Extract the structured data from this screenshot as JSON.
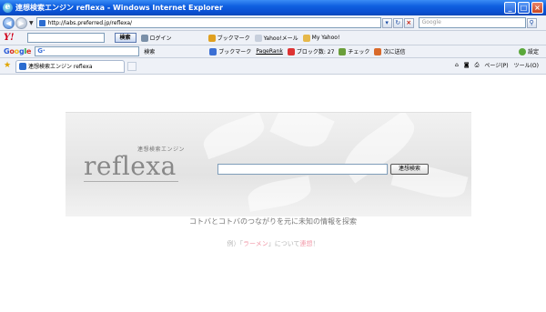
{
  "window": {
    "title": "連想検索エンジン reflexa - Windows Internet Explorer",
    "ie_icon": "e"
  },
  "address": {
    "url": "http://labs.preferred.jp/reflexa/",
    "search_placeholder": "Google"
  },
  "yahoo_toolbar": {
    "logo": "Y!",
    "search_button": "検索",
    "items": [
      {
        "icon": "login-icon",
        "label": "ログイン"
      },
      {
        "icon": "bookmark-star-icon",
        "label": "ブックマーク"
      },
      {
        "icon": "mail-icon",
        "label": "Yahoo!メール"
      },
      {
        "icon": "folder-icon",
        "label": "My Yahoo!"
      }
    ]
  },
  "google_toolbar": {
    "logo": "Google",
    "search_label": "検索",
    "items": [
      {
        "icon": "star-icon",
        "label": "ブックマーク"
      },
      {
        "icon": "pagerank-icon",
        "label": "PageRank"
      },
      {
        "icon": "blocked-icon",
        "label": "ブロック数: 27"
      },
      {
        "icon": "spellcheck-icon",
        "label": "チェック"
      },
      {
        "icon": "sendto-icon",
        "label": "次に送信"
      },
      {
        "icon": "settings-icon",
        "label": "設定"
      }
    ]
  },
  "tabs": {
    "active_tab": "連想検索エンジン reflexa",
    "page_menu": "ページ(P)",
    "tools_menu": "ツール(O)"
  },
  "page": {
    "subtitle": "連想検索エンジン",
    "logo": "reflexa",
    "search_button": "連想検索",
    "tagline": "コトバとコトバのつながりを元に未知の情報を探索",
    "example_prefix": "例）「",
    "example_keyword": "ラーメン",
    "example_middle": "」について",
    "example_action": "連想",
    "example_suffix": "！"
  },
  "colors": {
    "titlebar": "#0f5fe0",
    "example_keyword": "#f29aa9",
    "yahoo_red": "#d0021b"
  }
}
